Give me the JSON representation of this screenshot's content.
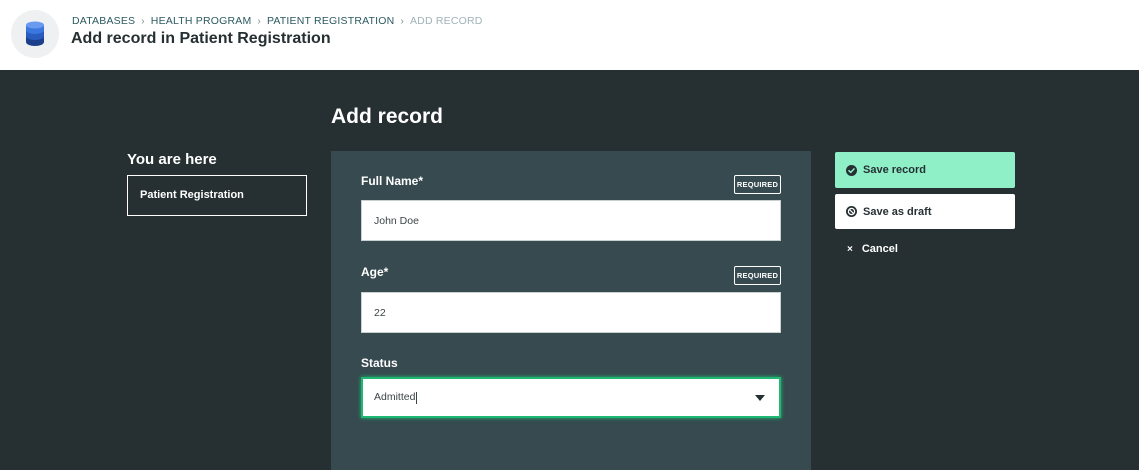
{
  "header": {
    "logo_icon": "database-icon",
    "breadcrumb": [
      "DATABASES",
      "HEALTH PROGRAM",
      "PATIENT REGISTRATION",
      "ADD RECORD"
    ],
    "breadcrumb_separator": "›",
    "title": "Add record in Patient Registration"
  },
  "sidebar": {
    "heading": "You are here",
    "location": "Patient Registration"
  },
  "form": {
    "heading": "Add record",
    "fields": [
      {
        "label": "Full Name*",
        "badge": "REQUIRED",
        "value": "John Doe"
      },
      {
        "label": "Age*",
        "badge": "REQUIRED",
        "value": "22"
      },
      {
        "label": "Status",
        "value": "Admitted",
        "icon": "chevron-down-icon"
      }
    ]
  },
  "actions": {
    "save": {
      "label": "Save record",
      "icon": "check-circle-icon"
    },
    "draft": {
      "label": "Save as draft",
      "icon": "ban-icon"
    },
    "cancel": {
      "label": "Cancel",
      "icon": "close-icon",
      "symbol": "×"
    }
  },
  "colors": {
    "dark_bg": "#262f32",
    "panel_bg": "#364a4f",
    "accent_green": "#8ff0c8",
    "focus_green": "#1fb872",
    "breadcrumb_link": "#2b5a61"
  }
}
